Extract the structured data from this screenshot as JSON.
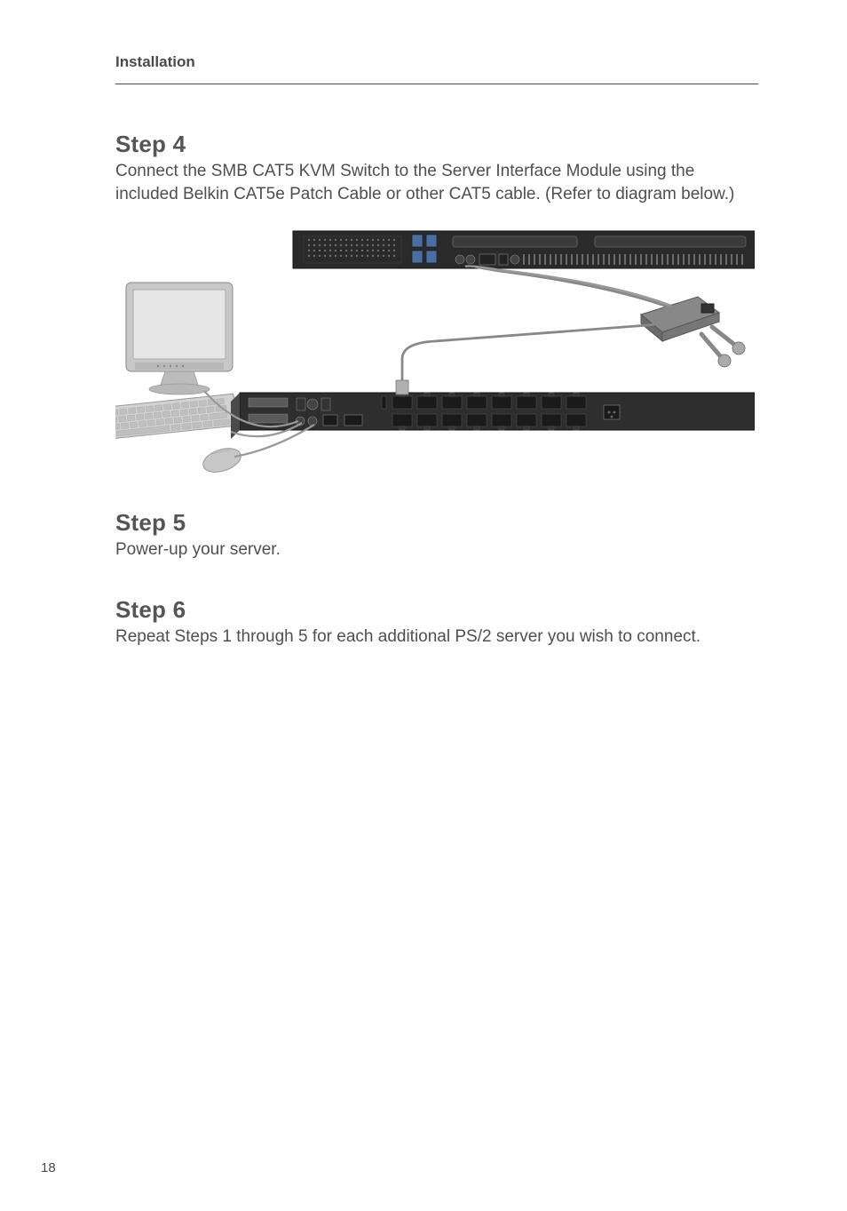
{
  "header": {
    "section_title": "Installation"
  },
  "steps": {
    "step4": {
      "heading": "Step 4",
      "body": "Connect the SMB CAT5 KVM Switch to the Server Interface Module using the included Belkin CAT5e Patch Cable or other CAT5 cable. (Refer to diagram below.)"
    },
    "step5": {
      "heading": "Step 5",
      "body": "Power-up your server."
    },
    "step6": {
      "heading": "Step 6",
      "body": "Repeat Steps 1 through 5 for each additional PS/2 server you wish to connect."
    }
  },
  "page": {
    "number": "18"
  },
  "diagram": {
    "alt": "Wiring diagram: KVM switch connected to server interface module via CAT5 cable, with monitor, keyboard, mouse and server rack ports",
    "labels": {
      "monitor": "monitor",
      "keyboard": "keyboard",
      "mouse": "mouse",
      "kvm_switch": "kvm-switch",
      "server_back": "server-back-panel",
      "interface_module": "server-interface-module",
      "cat5_cable": "cat5-cable"
    }
  }
}
